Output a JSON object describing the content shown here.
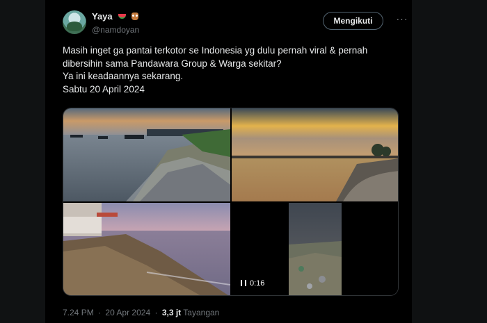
{
  "user": {
    "display_name": "Yaya",
    "handle": "@namdoyan",
    "emoji": [
      "watermelon-icon",
      "owl-icon"
    ]
  },
  "actions": {
    "follow_label": "Mengikuti",
    "more_label": "···"
  },
  "tweet": {
    "lines": [
      "Masih inget ga pantai terkotor se Indonesia yg dulu pernah viral & pernah",
      "dibersihin sama Pandawara Group & Warga sekitar?",
      "Ya ini keadaannya sekarang.",
      "Sabtu 20 April 2024"
    ]
  },
  "media": {
    "video_duration": "0:16",
    "icons": [
      "pause-icon"
    ]
  },
  "meta": {
    "time": "7.24 PM",
    "separator": "·",
    "date": "20 Apr 2024",
    "views_count": "3,3 jt",
    "views_label": "Tayangan"
  },
  "colors": {
    "background": "#000000",
    "text": "#e7e9ea",
    "muted": "#71767b",
    "border": "#2f3336"
  }
}
